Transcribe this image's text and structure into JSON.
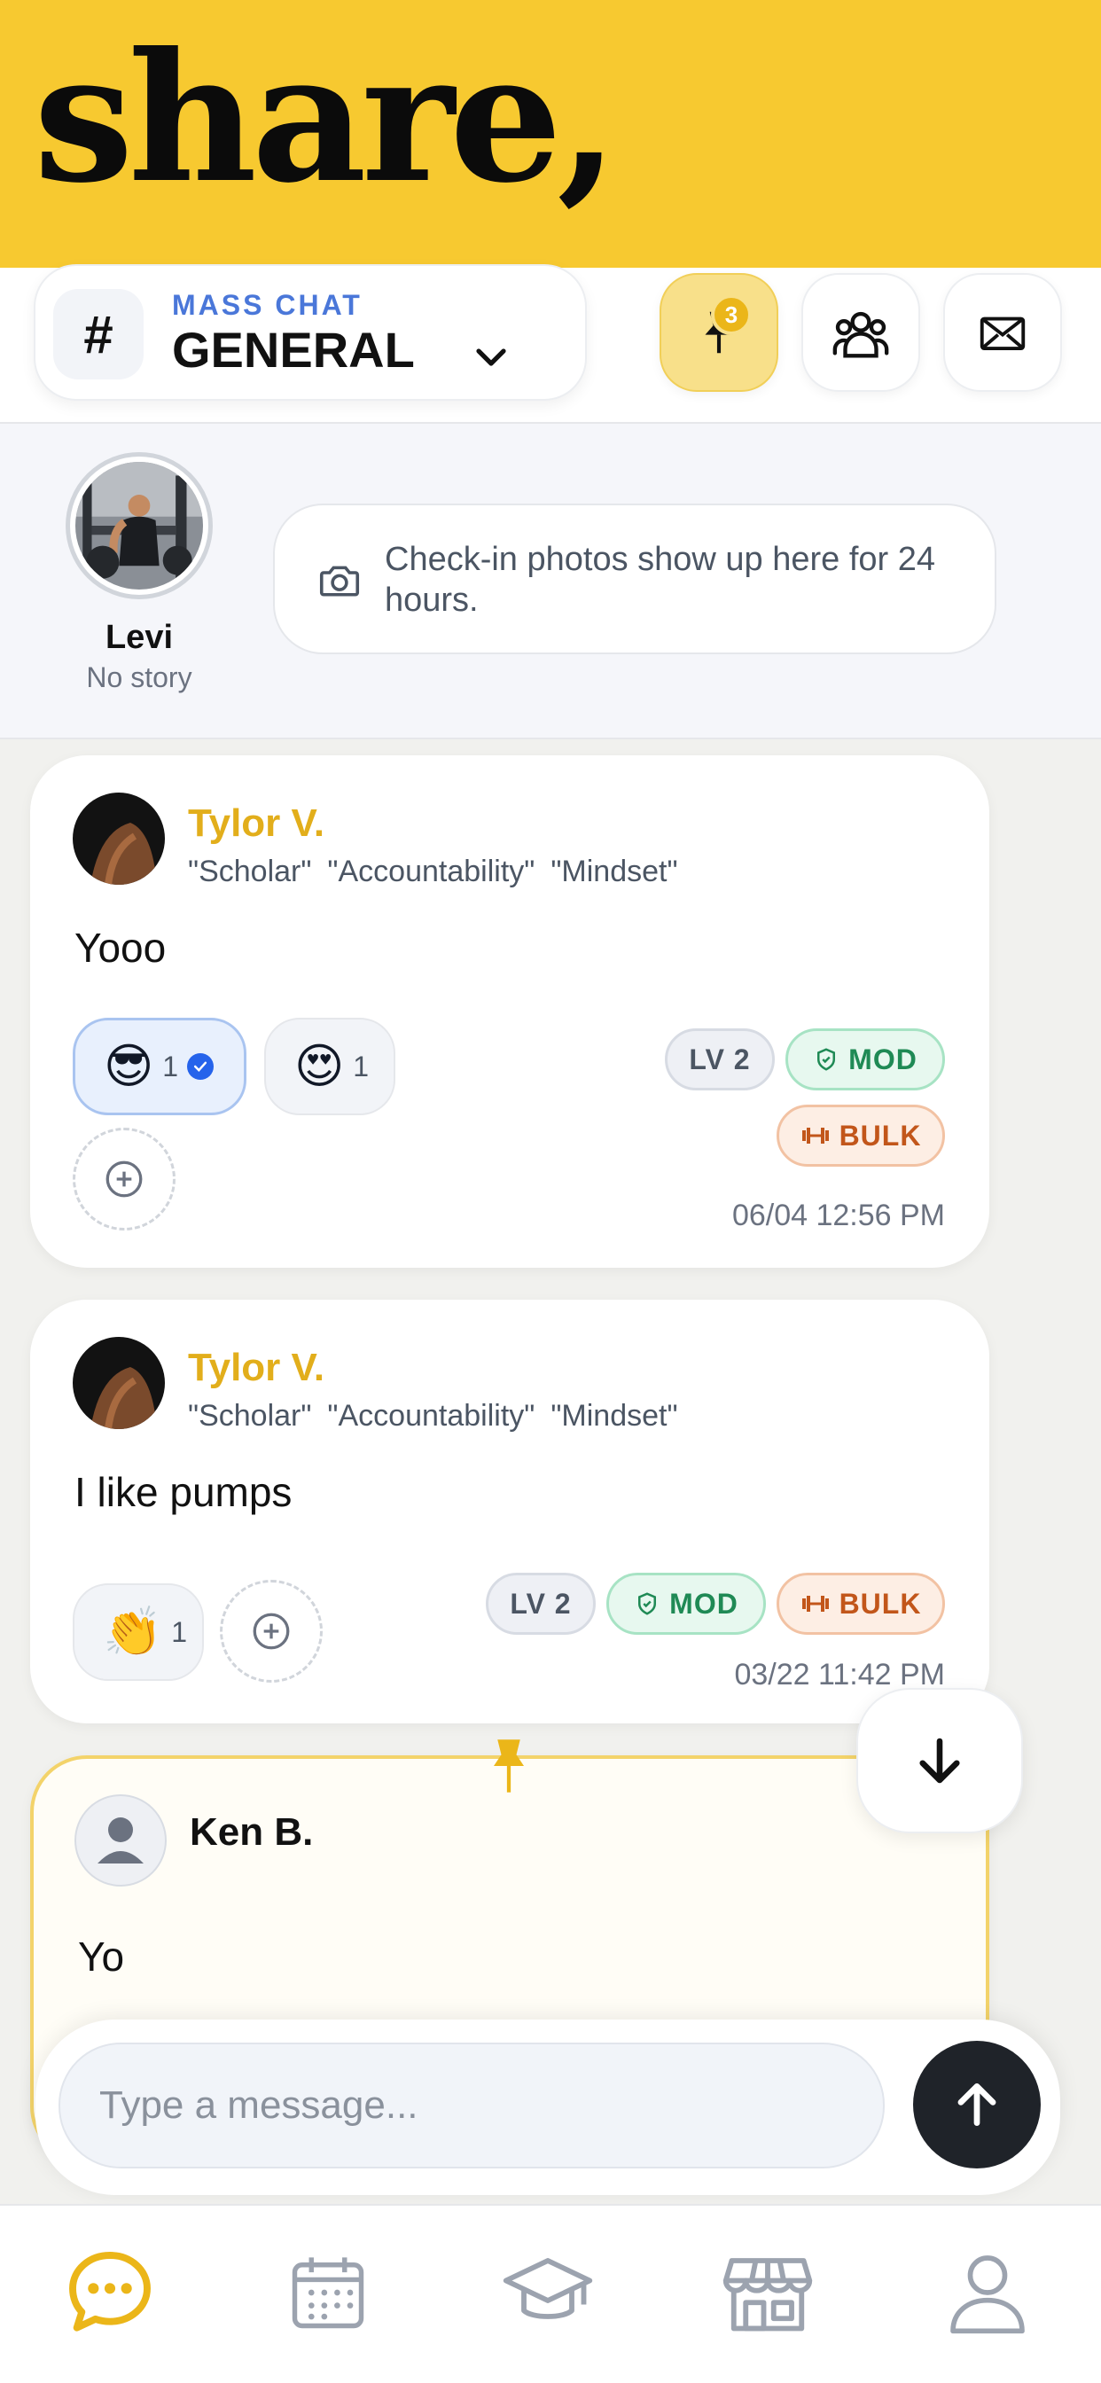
{
  "promo": {
    "headline": "share,"
  },
  "channel": {
    "label": "MASS CHAT",
    "name": "GENERAL",
    "hash": "#"
  },
  "pinned": {
    "count": "3"
  },
  "stories": {
    "user": {
      "name": "Levi",
      "status": "No story"
    },
    "checkin_hint": "Check-in photos show up here for 24 hours."
  },
  "messages": [
    {
      "author": "Tylor V.",
      "titles": [
        "\"Scholar\"",
        "\"Accountability\"",
        "\"Mindset\""
      ],
      "text": "Yooo",
      "reactions": [
        {
          "emoji": "😎",
          "count": "1",
          "mine": true
        },
        {
          "emoji": "😍",
          "count": "1",
          "mine": false
        }
      ],
      "badges": {
        "level": "LV 2",
        "role": "MOD",
        "goal": "BULK"
      },
      "timestamp": "06/04 12:56 PM"
    },
    {
      "author": "Tylor V.",
      "titles": [
        "\"Scholar\"",
        "\"Accountability\"",
        "\"Mindset\""
      ],
      "text": "I like pumps",
      "reactions": [
        {
          "emoji": "👏",
          "count": "1",
          "mine": false
        }
      ],
      "badges": {
        "level": "LV 2",
        "role": "MOD",
        "goal": "BULK"
      },
      "timestamp": "03/22 11:42 PM"
    },
    {
      "author": "Ken B.",
      "text": "Yo",
      "pinned": true
    }
  ],
  "composer": {
    "placeholder": "Type a message..."
  },
  "tabs": [
    "chat-icon",
    "calendar-icon",
    "graduation-cap-icon",
    "store-icon",
    "profile-icon"
  ],
  "colors": {
    "brand_yellow": "#F7C930",
    "author_gold": "#E2AE1B",
    "accent_blue": "#4a77d9",
    "mod_green": "#1f8a55",
    "bulk_orange": "#c2561a"
  }
}
